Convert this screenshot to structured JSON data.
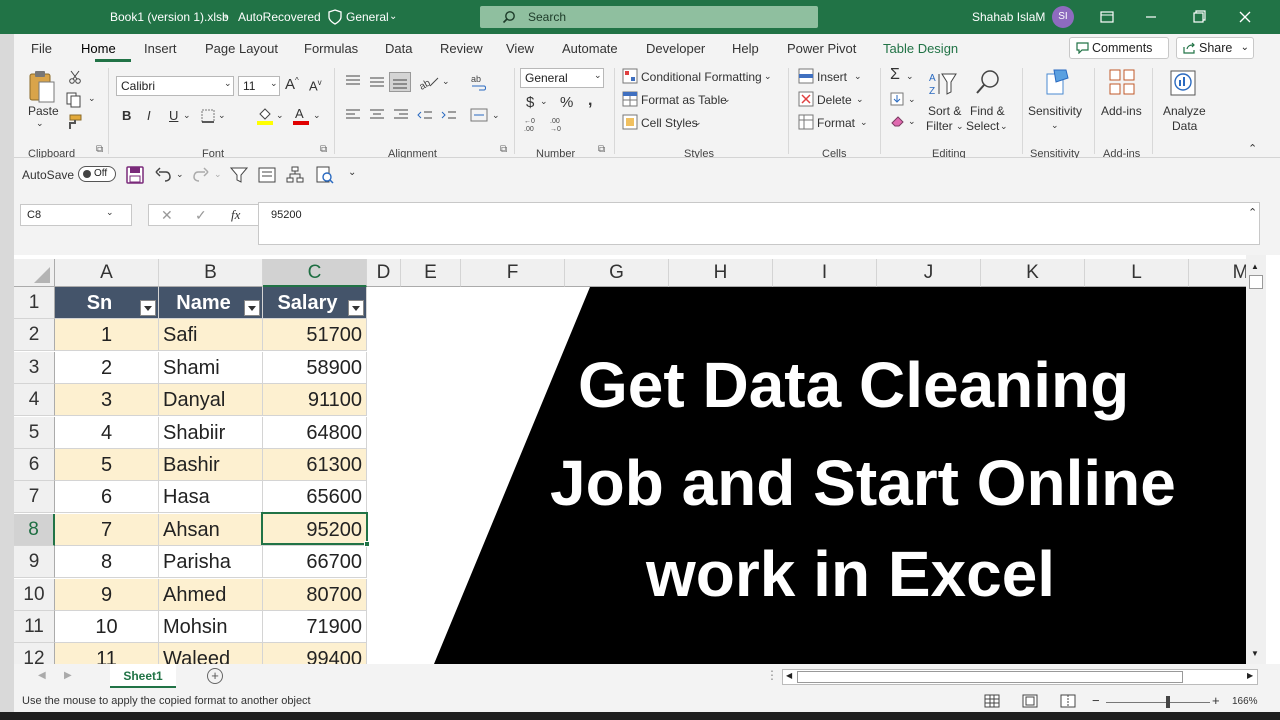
{
  "title_bar": {
    "filename": "Book1 (version 1).xlsb",
    "autorecovered": "AutoRecovered",
    "sensitivity": "General",
    "search_placeholder": "Search",
    "user_name": "Shahab IslaM",
    "user_initials": "SI"
  },
  "menu": {
    "tabs": [
      "File",
      "Home",
      "Insert",
      "Page Layout",
      "Formulas",
      "Data",
      "Review",
      "View",
      "Automate",
      "Developer",
      "Help",
      "Power Pivot",
      "Table Design"
    ],
    "active_tab": "Home",
    "comments_label": "Comments",
    "share_label": "Share"
  },
  "ribbon": {
    "clipboard": {
      "paste": "Paste",
      "group": "Clipboard"
    },
    "font": {
      "name": "Calibri",
      "size": "11",
      "bold": "B",
      "italic": "I",
      "underline": "U",
      "group": "Font"
    },
    "alignment": {
      "group": "Alignment"
    },
    "number": {
      "format": "General",
      "group": "Number"
    },
    "styles": {
      "conditional_formatting": "Conditional Formatting",
      "format_as_table": "Format as Table",
      "cell_styles": "Cell Styles",
      "group": "Styles"
    },
    "cells": {
      "insert": "Insert",
      "delete": "Delete",
      "format": "Format",
      "group": "Cells"
    },
    "editing": {
      "sort_filter_1": "Sort &",
      "sort_filter_2": "Filter",
      "find_select_1": "Find &",
      "find_select_2": "Select",
      "group": "Editing"
    },
    "sensitivity": {
      "label": "Sensitivity",
      "group": "Sensitivity"
    },
    "addins": {
      "label": "Add-ins",
      "group": "Add-ins"
    },
    "analyze": {
      "line1": "Analyze",
      "line2": "Data"
    }
  },
  "qat": {
    "autosave": "AutoSave",
    "autosave_state": "Off"
  },
  "formula_bar": {
    "name_box": "C8",
    "formula": "95200"
  },
  "grid": {
    "columns": [
      "A",
      "B",
      "C",
      "D",
      "E",
      "F",
      "G",
      "H",
      "I",
      "J",
      "K",
      "L",
      "M"
    ],
    "rows": [
      "1",
      "2",
      "3",
      "4",
      "5",
      "6",
      "7",
      "8",
      "9",
      "10",
      "11",
      "12"
    ],
    "selected_cell": "C8",
    "table_headers": [
      "Sn",
      "Name",
      "Salary"
    ],
    "table_rows": [
      [
        "1",
        "Safi",
        "51700"
      ],
      [
        "2",
        "Shami",
        "58900"
      ],
      [
        "3",
        "Danyal",
        "91100"
      ],
      [
        "4",
        "Shabiir",
        "64800"
      ],
      [
        "5",
        "Bashir",
        "61300"
      ],
      [
        "6",
        "Hasa",
        "65600"
      ],
      [
        "7",
        "Ahsan",
        "95200"
      ],
      [
        "8",
        "Parisha",
        "66700"
      ],
      [
        "9",
        "Ahmed",
        "80700"
      ],
      [
        "10",
        "Mohsin",
        "71900"
      ],
      [
        "11",
        "Waleed",
        "99400"
      ]
    ]
  },
  "banner": {
    "line1": "Get Data Cleaning",
    "line2": "Job and Start Online",
    "line3": "work in Excel"
  },
  "sheet_tabs": {
    "active": "Sheet1"
  },
  "status_bar": {
    "message": "Use the mouse to apply the copied format to another object",
    "zoom": "166%"
  },
  "colors": {
    "excel_green": "#217346",
    "table_header": "#44546a",
    "band": "#fdf0d0"
  }
}
